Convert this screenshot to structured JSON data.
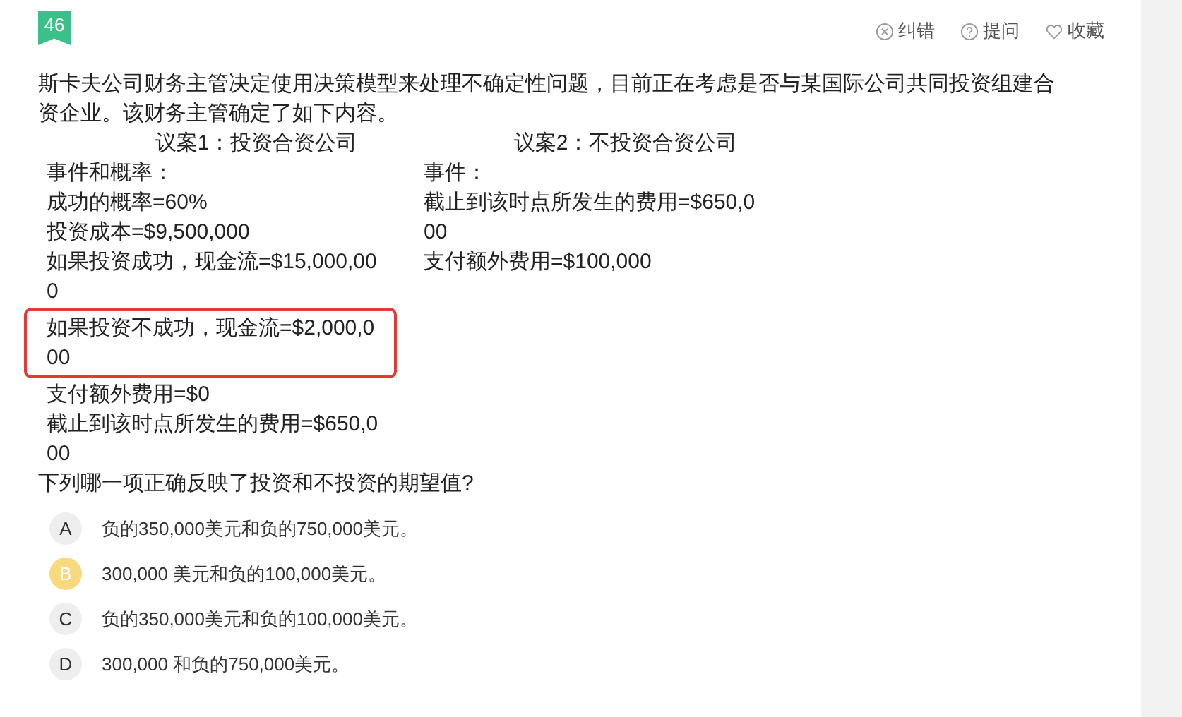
{
  "badge": "46",
  "actions": [
    {
      "kind": "error",
      "label": "纠错"
    },
    {
      "kind": "question",
      "label": "提问"
    },
    {
      "kind": "favorite",
      "label": "收藏"
    }
  ],
  "question": "斯卡夫公司财务主管决定使用决策模型来处理不确定性问题，目前正在考虑是否与某国际公司共同投资组建合资企业。该财务主管确定了如下内容。",
  "proposals": [
    {
      "heading": "议案1：投资合资公司",
      "lines": [
        {
          "text": "事件和概率：",
          "highlighted": false
        },
        {
          "text": "成功的概率=60%",
          "highlighted": false
        },
        {
          "text": "投资成本=$9,500,000",
          "highlighted": false
        },
        {
          "text": "如果投资成功，现金流=$15,000,000",
          "highlighted": false
        },
        {
          "text": "如果投资不成功，现金流=$2,000,000",
          "highlighted": true
        },
        {
          "text": "支付额外费用=$0",
          "highlighted": false
        },
        {
          "text": "截止到该时点所发生的费用=$650,000",
          "highlighted": false
        }
      ]
    },
    {
      "heading": "议案2：不投资合资公司",
      "lines": [
        {
          "text": "事件：",
          "highlighted": false
        },
        {
          "text": "截止到该时点所发生的费用=$650,000",
          "highlighted": false
        },
        {
          "text": "支付额外费用=$100,000",
          "highlighted": false
        }
      ]
    }
  ],
  "prompt": "下列哪一项正确反映了投资和不投资的期望值?",
  "options": [
    {
      "letter": "A",
      "text": "负的350,000美元和负的750,000美元。",
      "selected": false
    },
    {
      "letter": "B",
      "text": "300,000 美元和负的100,000美元。",
      "selected": true
    },
    {
      "letter": "C",
      "text": "负的350,000美元和负的100,000美元。",
      "selected": false
    },
    {
      "letter": "D",
      "text": "300,000 和负的750,000美元。",
      "selected": false
    }
  ]
}
